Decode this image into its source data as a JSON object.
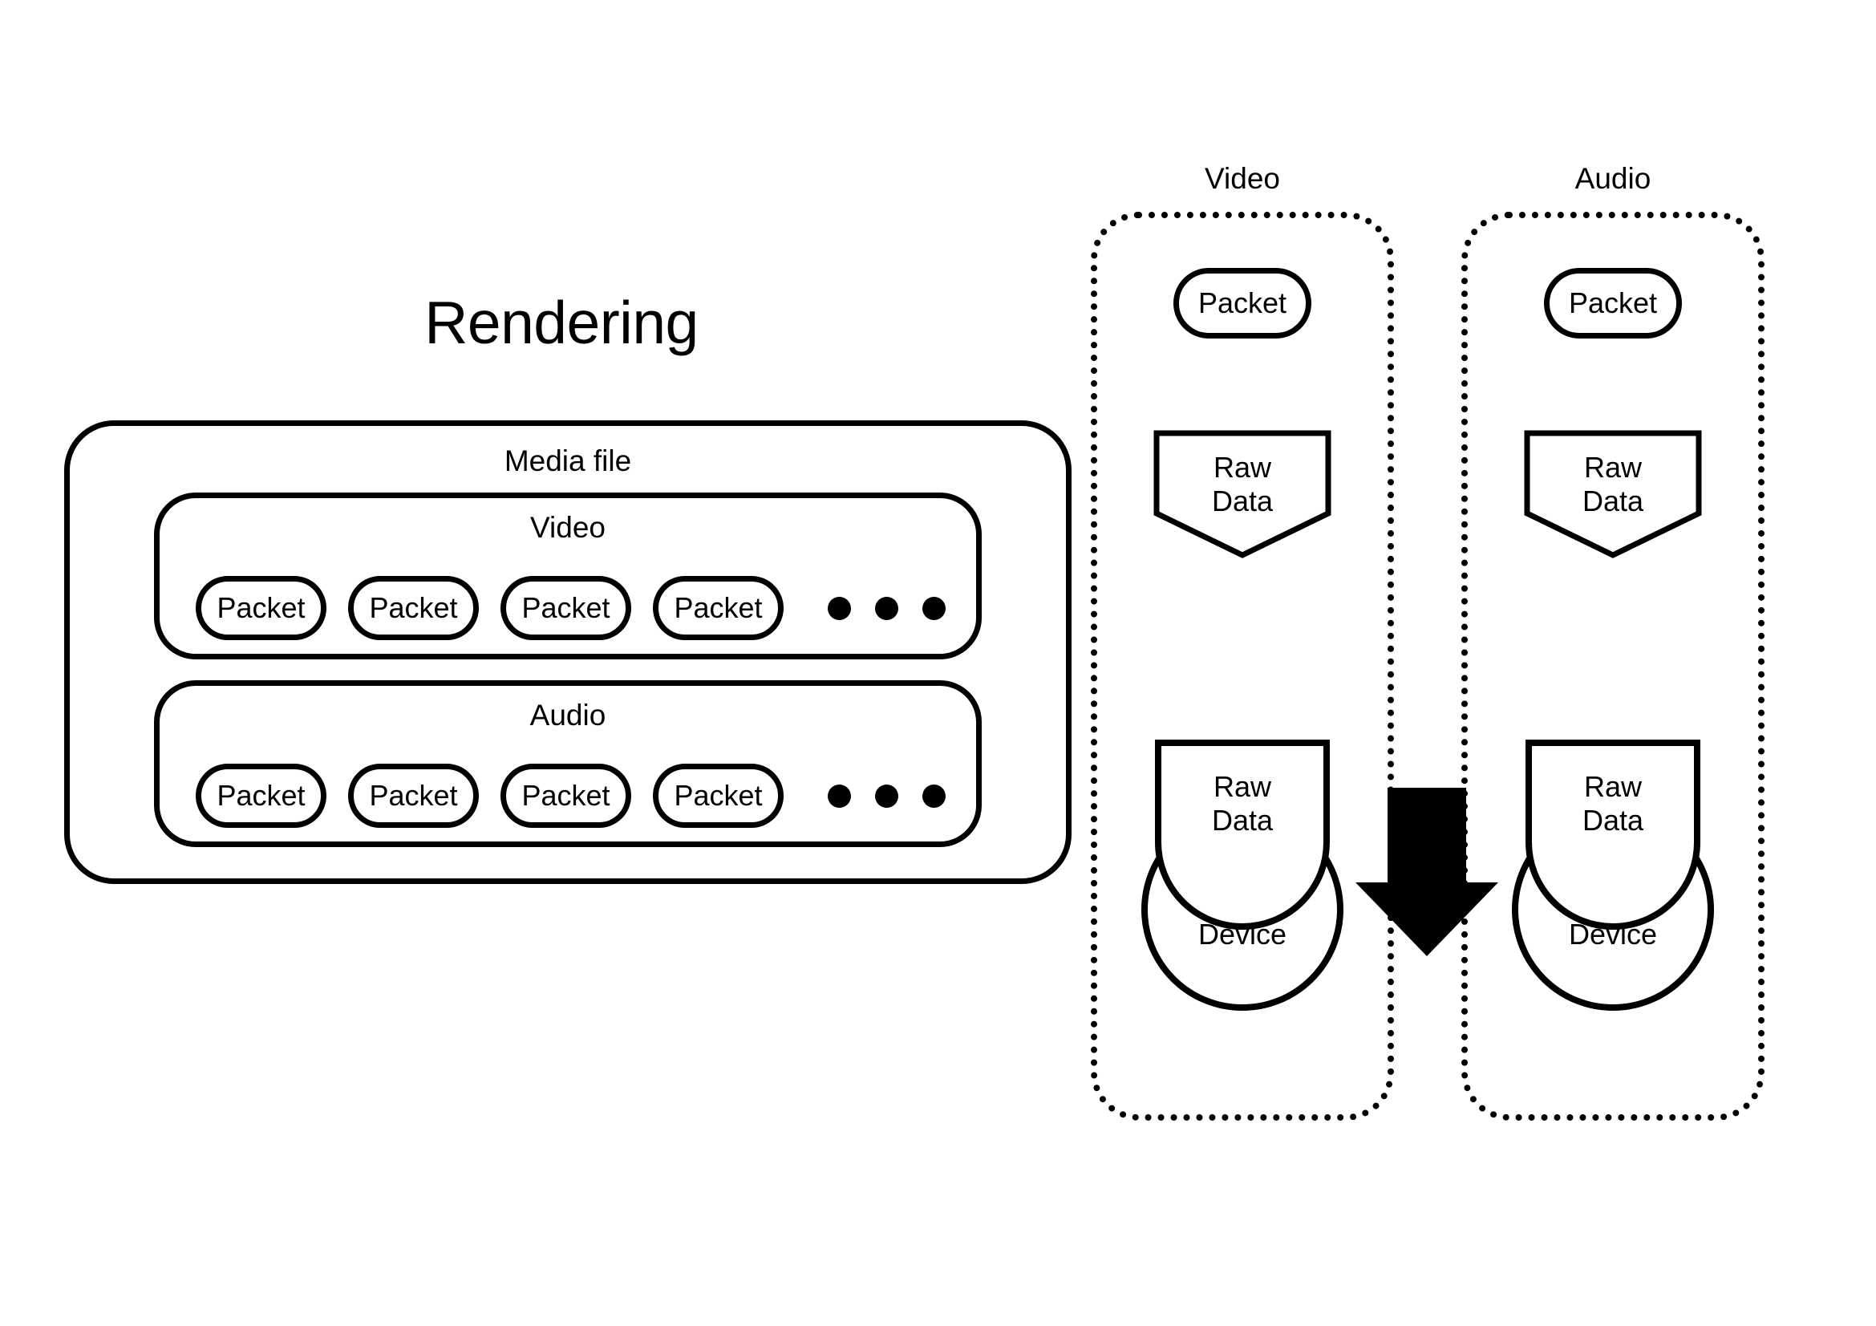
{
  "diagram": {
    "title": "Rendering",
    "media_file": {
      "label": "Media file",
      "streams": [
        {
          "label": "Video",
          "packets": [
            "Packet",
            "Packet",
            "Packet",
            "Packet"
          ],
          "ellipsis_dots": 3
        },
        {
          "label": "Audio",
          "packets": [
            "Packet",
            "Packet",
            "Packet",
            "Packet"
          ],
          "ellipsis_dots": 3
        }
      ]
    },
    "pipelines": [
      {
        "title": "Video",
        "packet_label": "Packet",
        "rawdata_label_line1": "Raw",
        "rawdata_label_line2": "Data",
        "output_rawdata_line1": "Raw",
        "output_rawdata_line2": "Data",
        "device_label": "Device"
      },
      {
        "title": "Audio",
        "packet_label": "Packet",
        "rawdata_label_line1": "Raw",
        "rawdata_label_line2": "Data",
        "output_rawdata_line1": "Raw",
        "output_rawdata_line2": "Data",
        "device_label": "Device"
      }
    ],
    "arrow": {
      "name": "down-arrow",
      "direction": "down"
    },
    "colors": {
      "stroke": "#000000",
      "background": "#ffffff",
      "fill": "#000000"
    }
  }
}
